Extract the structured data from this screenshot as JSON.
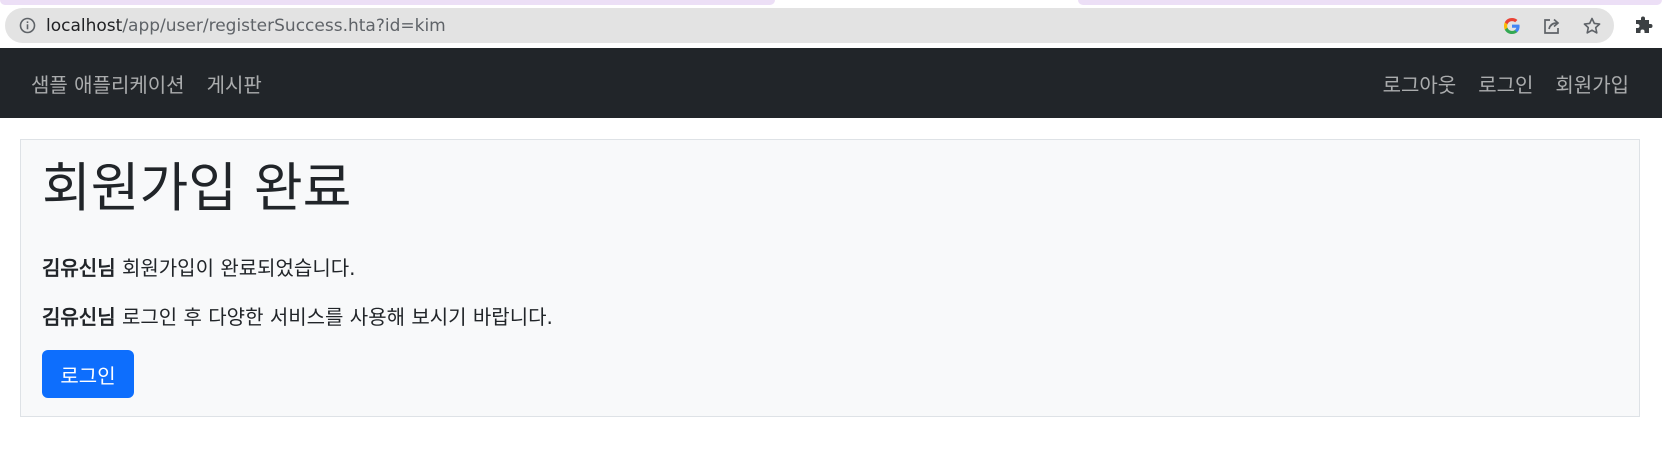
{
  "browser": {
    "url_host": "localhost",
    "url_path": "/app/user/registerSuccess.hta?id=kim",
    "icons": [
      "info-icon",
      "google-icon",
      "share-icon",
      "star-icon",
      "extensions-icon"
    ]
  },
  "navbar": {
    "brand": "샘플 애플리케이션",
    "links_left": [
      "게시판"
    ],
    "links_right": [
      "로그아웃",
      "로그인",
      "회원가입"
    ],
    "background": "#212529"
  },
  "main": {
    "title": "회원가입 완료",
    "message1": {
      "user": "김유신님",
      "text": " 회원가입이 완료되었습니다."
    },
    "message2": {
      "user": "김유신님",
      "text": " 로그인 후 다양한 서비스를 사용해 보시기 바랍니다."
    },
    "login_button": "로그인",
    "button_color": "#0d6efd"
  }
}
